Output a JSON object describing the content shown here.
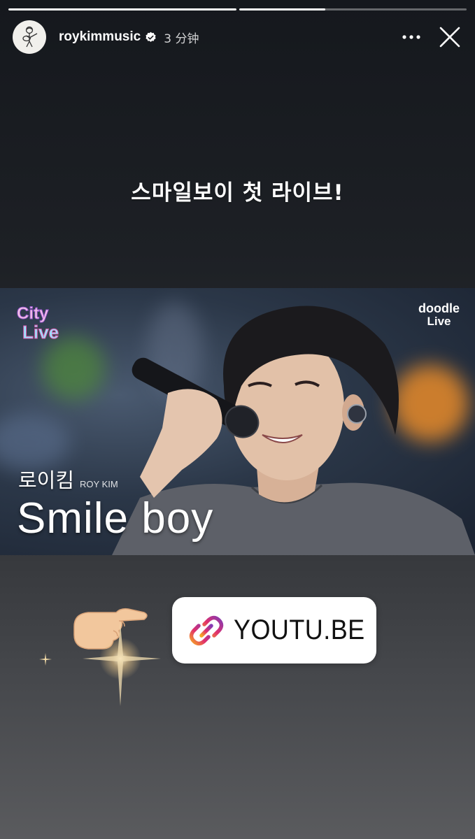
{
  "progress": {
    "segments": [
      {
        "state": "complete",
        "fill": 1.0
      },
      {
        "state": "current",
        "fill": 0.38
      }
    ]
  },
  "header": {
    "username": "roykimmusic",
    "verified": true,
    "time": "3 分钟",
    "more_icon": "more-horizontal-icon",
    "close_icon": "close-icon"
  },
  "caption": "스마일보이 첫 라이브!",
  "video": {
    "show_logo": "City Live",
    "channel_logo_line1": "doodle",
    "channel_logo_line2": "Live",
    "artist_ko": "로이킴",
    "artist_en": "ROY KIM",
    "song_title": "Smile boy"
  },
  "link_sticker": {
    "icon": "link-icon",
    "label": "YOUTU.BE"
  },
  "decorations": {
    "pointing_hand": "backhand-index-pointing-right",
    "sparkle": "sparkle"
  }
}
